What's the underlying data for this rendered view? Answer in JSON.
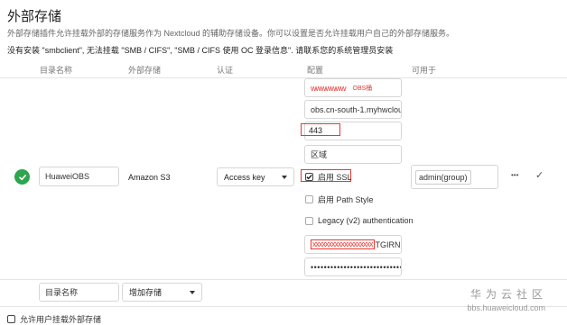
{
  "page": {
    "title": "外部存储",
    "description": "外部存储插件允许挂载外部的存储服务作为 Nextcloud 的辅助存储设备。你可以设置是否允许挂载用户自己的外部存储服务。",
    "warning_bold": "没有安装 \"smbclient\", 无法挂载 \"SMB / CIFS\", \"SMB / CIFS 使用 OC 登录信息\". 请联系您的系统管理员安装"
  },
  "table": {
    "headers": {
      "folder_name": "目录名称",
      "external_storage": "外部存储",
      "authentication": "认证",
      "configuration": "配置",
      "available_for": "可用于"
    }
  },
  "mount": {
    "folder_name": "HuaweiOBS",
    "storage_type": "Amazon S3",
    "auth": "Access key",
    "config": {
      "bucket_masked": "wwwwwww",
      "bucket_label": "OBS桶",
      "hostname": "obs.cn-south-1.myhwclouc",
      "port": "443",
      "region_placeholder": "区域",
      "enable_ssl": "启用 SSL",
      "path_style": "启用 Path Style",
      "legacy_auth": "Legacy (v2) authentication",
      "access_key_masked": "xxxxxxxxxxxxxxxxxxx",
      "access_key_suffix": "TGIRNL",
      "secret_key": "••••••••••••••••••••••••••••••••••"
    },
    "available_for": "admin(group)",
    "more_actions": "•••",
    "save_symbol": "✓"
  },
  "new_row": {
    "folder_placeholder": "目录名称",
    "add_storage": "增加存储"
  },
  "footer": {
    "allow_user_mount": "允许用户挂载外部存储"
  },
  "watermark": {
    "cn": "华为云社区",
    "en": "bbs.huaweicloud.com"
  },
  "colors": {
    "success": "#2ea44f",
    "highlight": "#e53935",
    "border": "#d6d6d6"
  }
}
